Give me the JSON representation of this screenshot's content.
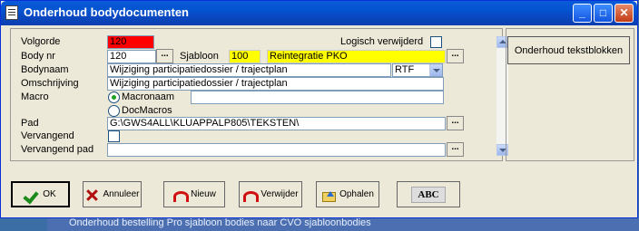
{
  "window": {
    "title": "Onderhoud bodydocumenten"
  },
  "background": {
    "text": "Onderhoud bestelling Pro sjabloon bodies naar CVO sjabloonbodies"
  },
  "form": {
    "volgorde": {
      "label": "Volgorde",
      "value": "120"
    },
    "logisch_verwijderd": {
      "label": "Logisch verwijderd",
      "checked": false
    },
    "body_nr": {
      "label": "Body nr",
      "value": "120"
    },
    "sjabloon": {
      "label": "Sjabloon",
      "code": "100",
      "name": "Reintegratie PKO"
    },
    "bodynaam": {
      "label": "Bodynaam",
      "value": "Wijziging participatiedossier / trajectplan",
      "format": "RTF"
    },
    "omschrijving": {
      "label": "Omschrijving",
      "value": "Wijziging participatiedossier / trajectplan"
    },
    "macro": {
      "label": "Macro",
      "options": [
        "Macronaam",
        "DocMacros"
      ],
      "selected": "Macronaam",
      "value": ""
    },
    "pad": {
      "label": "Pad",
      "value": "G:\\GWS4ALL\\KLUAPPALP805\\TEKSTEN\\"
    },
    "vervangend": {
      "label": "Vervangend",
      "checked": false
    },
    "vervangend_pad": {
      "label": "Vervangend pad",
      "value": ""
    },
    "browse_label": "..."
  },
  "side": {
    "tekstblokken_button": "Onderhoud tekstblokken"
  },
  "buttons": {
    "ok": "OK",
    "annuleer": "Annuleer",
    "nieuw": "Nieuw",
    "verwijder": "Verwijder",
    "ophalen": "Ophalen",
    "spelling": "ABC"
  }
}
